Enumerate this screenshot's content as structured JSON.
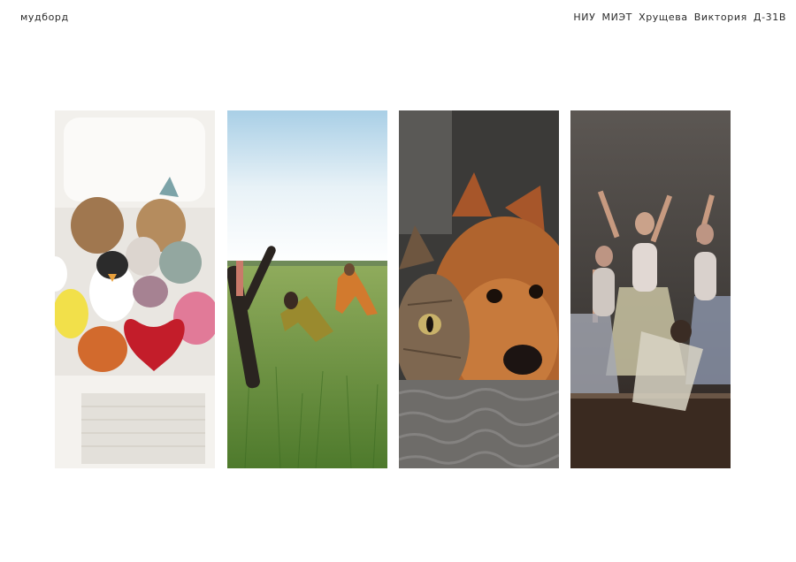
{
  "header": {
    "left_title": "мудборд",
    "right_caption": "НИУ МИЭТ Хрущева Виктория Д-31В"
  },
  "images": [
    {
      "subject": "plush-toys-on-bed"
    },
    {
      "subject": "yoga-in-meadow"
    },
    {
      "subject": "cat-and-dog"
    },
    {
      "subject": "ballet-dancers"
    }
  ]
}
